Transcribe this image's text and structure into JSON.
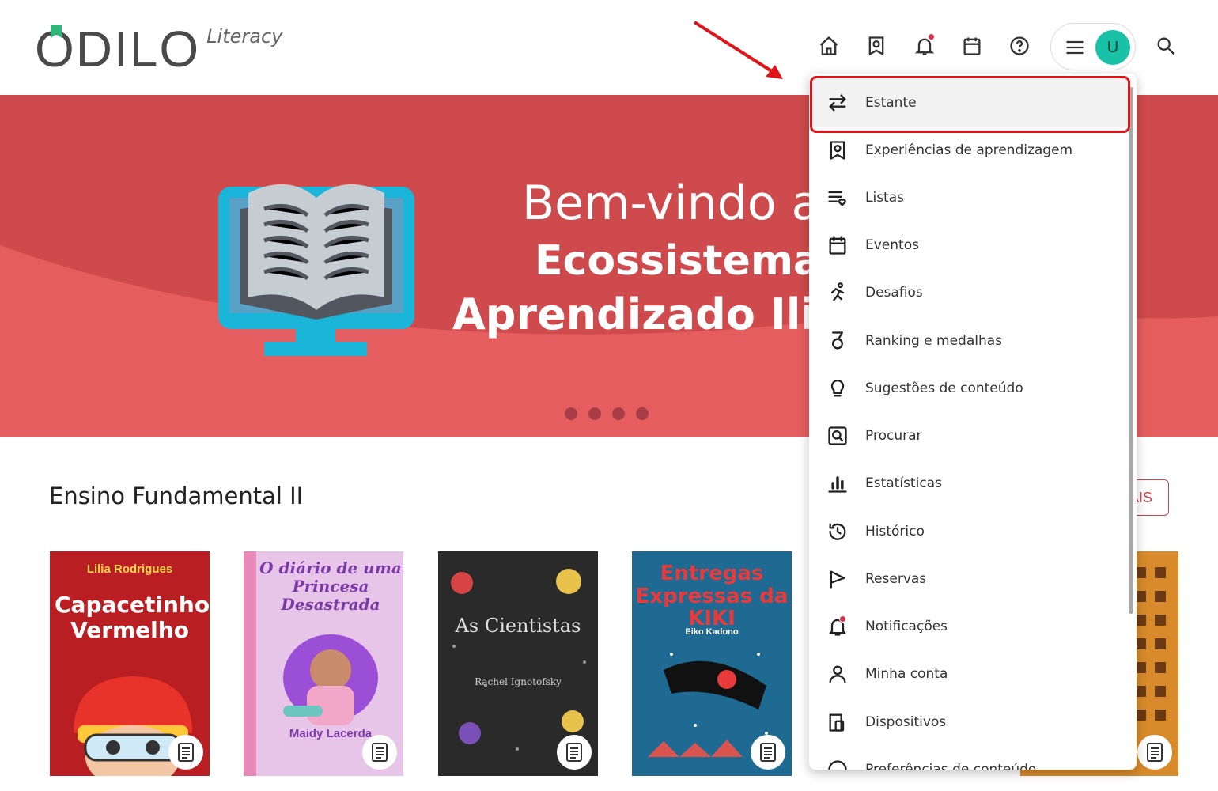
{
  "app": {
    "logo_text": "ODILO",
    "logo_sub": "Literacy",
    "avatar_initial": "U",
    "accent_color": "#cf4a4c",
    "avatar_color": "#19c2a6"
  },
  "header_icons": [
    "home-icon",
    "bookmark-badge-icon",
    "bell-icon",
    "calendar-icon",
    "help-icon",
    "menu-icon",
    "search-icon"
  ],
  "banner": {
    "title_line1": "Bem-vindo ao",
    "title_line2": "Ecossistema",
    "title_line3": "Aprendizado Ili",
    "slides": 4
  },
  "section": {
    "title": "Ensino Fundamental II",
    "more_label": "AIS"
  },
  "books": [
    {
      "title": "Capacetinho Vermelho",
      "author": "Lilia Rodrigues",
      "cover_color": "#b91f22"
    },
    {
      "title": "O diário de uma Princesa Desastrada",
      "author": "Maidy Lacerda",
      "cover_color": "#e7c5e8"
    },
    {
      "title": "As Cientistas",
      "author": "Rachel Ignotofsky",
      "cover_color": "#2a2a2a"
    },
    {
      "title": "Entregas Expressas da KIKI",
      "author": "Eiko Kadono",
      "cover_color": "#1e6a92"
    },
    {
      "title": "",
      "author": "",
      "cover_color": "#d98a2a"
    }
  ],
  "menu": {
    "items": [
      {
        "label": "Estante",
        "icon": "swap-arrows-icon"
      },
      {
        "label": "Experiências de aprendizagem",
        "icon": "bookmark-badge-icon"
      },
      {
        "label": "Listas",
        "icon": "list-heart-icon"
      },
      {
        "label": "Eventos",
        "icon": "calendar-icon"
      },
      {
        "label": "Desafios",
        "icon": "running-icon"
      },
      {
        "label": "Ranking e medalhas",
        "icon": "medal-icon"
      },
      {
        "label": "Sugestões de conteúdo",
        "icon": "lightbulb-icon"
      },
      {
        "label": "Procurar",
        "icon": "search-box-icon"
      },
      {
        "label": "Estatísticas",
        "icon": "bar-chart-icon"
      },
      {
        "label": "Histórico",
        "icon": "history-icon"
      },
      {
        "label": "Reservas",
        "icon": "flag-icon"
      },
      {
        "label": "Notificações",
        "icon": "bell-icon"
      },
      {
        "label": "Minha conta",
        "icon": "user-icon"
      },
      {
        "label": "Dispositivos",
        "icon": "devices-icon"
      },
      {
        "label": "Preferências de conteúdo",
        "icon": "smile-icon"
      }
    ]
  }
}
